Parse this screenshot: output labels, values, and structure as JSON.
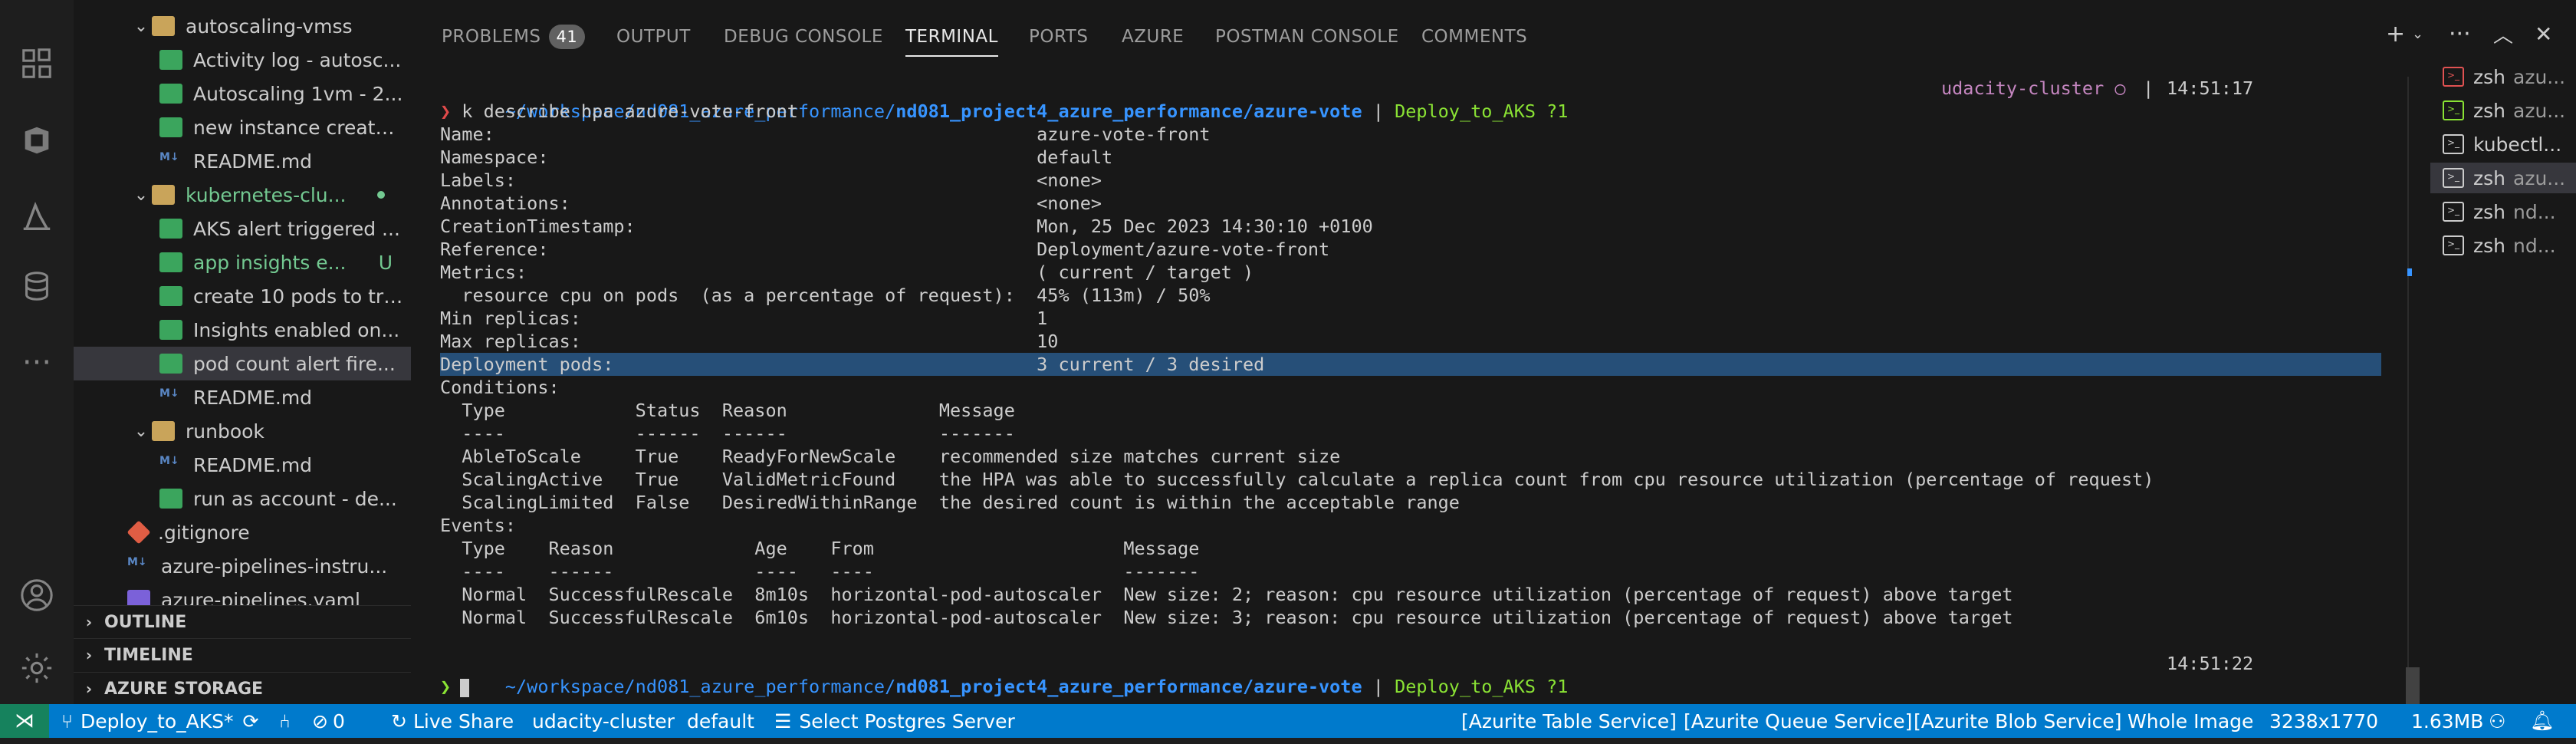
{
  "sidebar": {
    "items": [
      {
        "label": "autoscaling-vmss",
        "kind": "folder",
        "depth": 1,
        "expanded": true
      },
      {
        "label": "Activity log - autosc...",
        "kind": "image",
        "depth": 2
      },
      {
        "label": "Autoscaling 1vm - 2...",
        "kind": "image",
        "depth": 2
      },
      {
        "label": "new instance create...",
        "kind": "image",
        "depth": 2
      },
      {
        "label": "README.md",
        "kind": "md",
        "depth": 2
      },
      {
        "label": "kubernetes-clu...",
        "kind": "folder",
        "depth": 1,
        "expanded": true,
        "modified": true
      },
      {
        "label": "AKS alert triggered ...",
        "kind": "image",
        "depth": 2
      },
      {
        "label": "app insights e...",
        "kind": "image",
        "depth": 2,
        "modified": true,
        "git_status": "U"
      },
      {
        "label": "create 10 pods to tri...",
        "kind": "image",
        "depth": 2
      },
      {
        "label": "Insights enabled on...",
        "kind": "image",
        "depth": 2
      },
      {
        "label": "pod count alert fire...",
        "kind": "image",
        "depth": 2,
        "selected": true
      },
      {
        "label": "README.md",
        "kind": "md",
        "depth": 2
      },
      {
        "label": "runbook",
        "kind": "folder",
        "depth": 1,
        "expanded": true
      },
      {
        "label": "README.md",
        "kind": "md",
        "depth": 2
      },
      {
        "label": "run as account - de...",
        "kind": "image",
        "depth": 2
      },
      {
        "label": ".gitignore",
        "kind": "git",
        "depth": 1
      },
      {
        "label": "azure-pipelines-instru...",
        "kind": "md",
        "depth": 1
      },
      {
        "label": "azure-pipelines.yaml",
        "kind": "yml",
        "depth": 1
      }
    ],
    "sections": [
      "OUTLINE",
      "TIMELINE",
      "AZURE STORAGE"
    ]
  },
  "panel": {
    "tabs": [
      {
        "label": "PROBLEMS",
        "badge": "41"
      },
      {
        "label": "OUTPUT"
      },
      {
        "label": "DEBUG CONSOLE"
      },
      {
        "label": "TERMINAL",
        "active": true
      },
      {
        "label": "PORTS"
      },
      {
        "label": "AZURE"
      },
      {
        "label": "POSTMAN CONSOLE"
      },
      {
        "label": "COMMENTS"
      }
    ],
    "toolbar_icons": [
      "plus-icon",
      "chevron-down-icon",
      "more-icon",
      "maximize-icon",
      "close-icon"
    ]
  },
  "terminal": {
    "prompt1": {
      "path_prefix": "~/workspace/nd081_azure_performance/",
      "path_main": "nd081_project4_azure_performance/azure-vote",
      "sep": " | ",
      "branch": "Deploy_to_AKS ?1",
      "cluster": "udacity-cluster ○",
      "sep2": " | ",
      "time": "14:51:17"
    },
    "command_prompt": "❯",
    "command": " k describe hpa azure-vote-front",
    "lines": [
      "Name:                                                  azure-vote-front",
      "Namespace:                                             default",
      "Labels:                                                <none>",
      "Annotations:                                           <none>",
      "CreationTimestamp:                                     Mon, 25 Dec 2023 14:30:10 +0100",
      "Reference:                                             Deployment/azure-vote-front",
      "Metrics:                                               ( current / target )",
      "  resource cpu on pods  (as a percentage of request):  45% (113m) / 50%",
      "Min replicas:                                          1",
      "Max replicas:                                          10",
      "Deployment pods:                                       3 current / 3 desired",
      "Conditions:",
      "  Type            Status  Reason              Message",
      "  ----            ------  ------              -------",
      "  AbleToScale     True    ReadyForNewScale    recommended size matches current size",
      "  ScalingActive   True    ValidMetricFound    the HPA was able to successfully calculate a replica count from cpu resource utilization (percentage of request)",
      "  ScalingLimited  False   DesiredWithinRange  the desired count is within the acceptable range",
      "Events:",
      "  Type    Reason             Age    From                       Message",
      "  ----    ------             ----   ----                       -------",
      "  Normal  SuccessfulRescale  8m10s  horizontal-pod-autoscaler  New size: 2; reason: cpu resource utilization (percentage of request) above target",
      "  Normal  SuccessfulRescale  6m10s  horizontal-pod-autoscaler  New size: 3; reason: cpu resource utilization (percentage of request) above target"
    ],
    "highlighted_line": 10,
    "prompt2": {
      "path_prefix": "~/workspace/nd081_azure_performance/",
      "path_main": "nd081_project4_azure_performance/azure-vote",
      "sep": " | ",
      "branch": "Deploy_to_AKS ?1",
      "time": "14:51:22"
    },
    "final_prompt": "❯"
  },
  "terminal_list": [
    {
      "name": "zsh",
      "sub": "azu...",
      "icon_color": "#e05252"
    },
    {
      "name": "zsh",
      "sub": "azu...",
      "icon_color": "#8ae234"
    },
    {
      "name": "kubectl...",
      "sub": "",
      "icon_color": "#cccccc"
    },
    {
      "name": "zsh",
      "sub": "azu...",
      "icon_color": "#cccccc",
      "selected": true
    },
    {
      "name": "zsh",
      "sub": "nd...",
      "icon_color": "#cccccc"
    },
    {
      "name": "zsh",
      "sub": "nd...",
      "icon_color": "#cccccc"
    }
  ],
  "statusbar": {
    "branch": "Deploy_to_AKS*",
    "errors": "0",
    "live_share": "Live Share",
    "cluster": "udacity-cluster",
    "namespace": "default",
    "postgres": "Select Postgres Server",
    "azurite_table": "[Azurite Table Service]",
    "azurite_queue": "[Azurite Queue Service]",
    "azurite_blob": "[Azurite Blob Service]",
    "image_mode": "Whole Image",
    "image_dims": "3238x1770",
    "image_size": "1.63MB"
  },
  "colors": {
    "accent": "#007acc",
    "remote": "#16825d",
    "selection": "#264f78",
    "path": "#3794ff",
    "branch": "#8ae234",
    "cluster": "#c586c0"
  }
}
